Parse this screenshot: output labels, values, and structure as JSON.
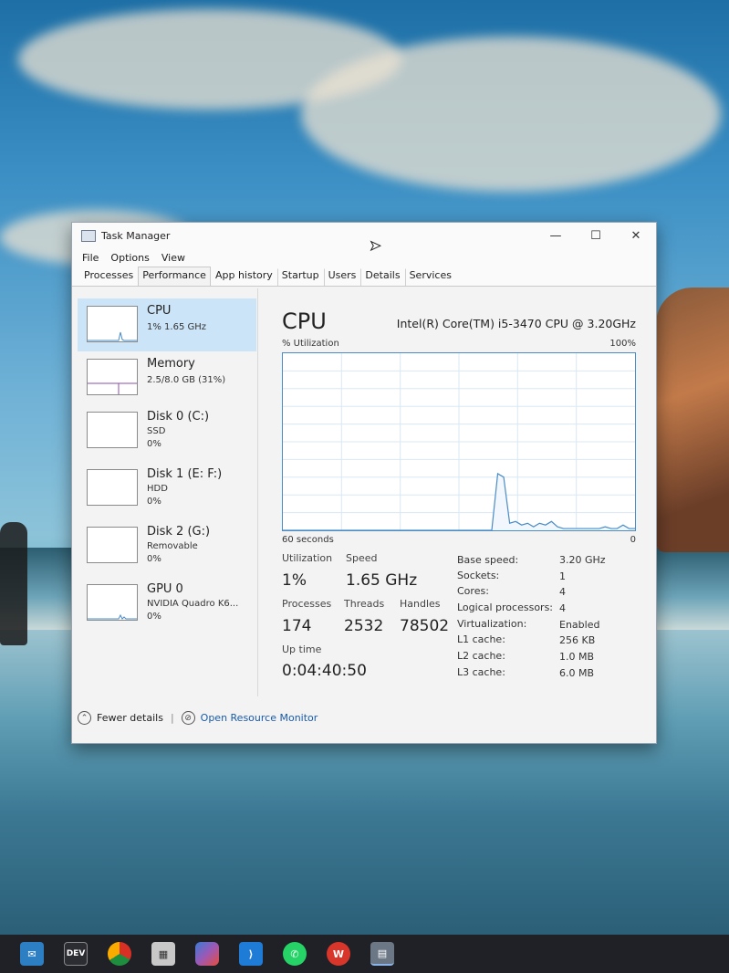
{
  "window": {
    "title": "Task Manager",
    "controls": {
      "minimize": "—",
      "maximize": "☐",
      "close": "✕"
    }
  },
  "menu": [
    "File",
    "Options",
    "View"
  ],
  "tabs": [
    "Processes",
    "Performance",
    "App history",
    "Startup",
    "Users",
    "Details",
    "Services"
  ],
  "sidebar": [
    {
      "name": "CPU",
      "sub1": "1%  1.65 GHz",
      "sub2": ""
    },
    {
      "name": "Memory",
      "sub1": "2.5/8.0 GB (31%)",
      "sub2": ""
    },
    {
      "name": "Disk 0 (C:)",
      "sub1": "SSD",
      "sub2": "0%"
    },
    {
      "name": "Disk 1 (E: F:)",
      "sub1": "HDD",
      "sub2": "0%"
    },
    {
      "name": "Disk 2 (G:)",
      "sub1": "Removable",
      "sub2": "0%"
    },
    {
      "name": "GPU 0",
      "sub1": "NVIDIA Quadro K6...",
      "sub2": "0%"
    }
  ],
  "cpu": {
    "title": "CPU",
    "model": "Intel(R) Core(TM) i5-3470 CPU @ 3.20GHz",
    "util_label": "% Utilization",
    "util_max": "100%",
    "axis_left": "60 seconds",
    "axis_right": "0",
    "utilization_label": "Utilization",
    "utilization": "1%",
    "speed_label": "Speed",
    "speed": "1.65 GHz",
    "processes_label": "Processes",
    "processes": "174",
    "threads_label": "Threads",
    "threads": "2532",
    "handles_label": "Handles",
    "handles": "78502",
    "uptime_label": "Up time",
    "uptime": "0:04:40:50",
    "details": [
      {
        "label": "Base speed:",
        "value": "3.20 GHz"
      },
      {
        "label": "Sockets:",
        "value": "1"
      },
      {
        "label": "Cores:",
        "value": "4"
      },
      {
        "label": "Logical processors:",
        "value": "4"
      },
      {
        "label": "Virtualization:",
        "value": "Enabled"
      },
      {
        "label": "L1 cache:",
        "value": "256 KB"
      },
      {
        "label": "L2 cache:",
        "value": "1.0 MB"
      },
      {
        "label": "L3 cache:",
        "value": "6.0 MB"
      }
    ],
    "history": [
      0,
      0,
      0,
      0,
      0,
      0,
      0,
      0,
      0,
      0,
      0,
      0,
      0,
      0,
      0,
      0,
      0,
      0,
      0,
      0,
      0,
      0,
      0,
      0,
      0,
      0,
      0,
      0,
      0,
      0,
      0,
      0,
      0,
      0,
      0,
      0,
      32,
      30,
      4,
      5,
      3,
      4,
      2,
      4,
      3,
      5,
      2,
      1,
      1,
      1,
      1,
      1,
      1,
      1,
      2,
      1,
      1,
      3,
      1,
      1
    ]
  },
  "footer": {
    "fewer": "Fewer details",
    "resource_monitor": "Open Resource Monitor"
  },
  "taskbar": [
    "mail",
    "DEV",
    "chrome",
    "store",
    "copilot",
    "vscode",
    "whatsapp",
    "wps",
    "taskmgr"
  ],
  "colors": {
    "accent": "#4a8cc7",
    "selected": "#cce4f7",
    "link": "#1a5aa6"
  }
}
